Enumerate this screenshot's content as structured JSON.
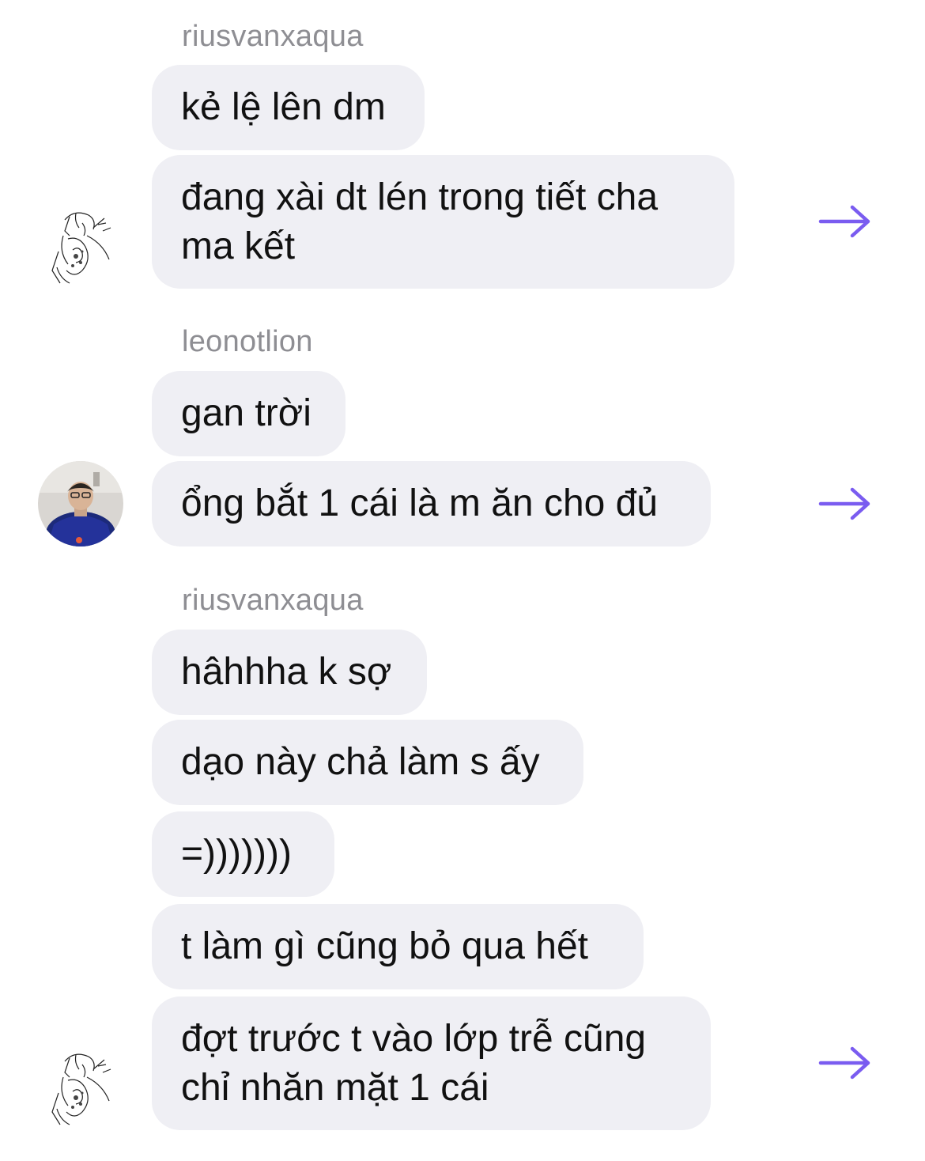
{
  "colors": {
    "bubble_bg": "#efeff4",
    "sender_name": "#8e8e93",
    "message_text": "#111111",
    "forward_arrow": "#7a5cf0"
  },
  "groups": [
    {
      "sender": "riusvanxaqua",
      "avatar_icon": "sketch-illustration-avatar",
      "messages": [
        "kẻ lệ lên dm",
        "đang xài dt lén trong tiết cha ma kết"
      ],
      "action_icon": "forward-arrow-icon"
    },
    {
      "sender": "leonotlion",
      "avatar_icon": "photo-avatar",
      "messages": [
        "gan trời",
        "ổng bắt 1 cái là m ăn cho đủ"
      ],
      "action_icon": "forward-arrow-icon"
    },
    {
      "sender": "riusvanxaqua",
      "avatar_icon": "sketch-illustration-avatar",
      "messages": [
        "hâhhha k sợ",
        "dạo này chả làm s ấy",
        "=)))))))",
        "t làm gì cũng bỏ qua hết",
        "đợt trước t vào lớp trễ cũng chỉ nhăn mặt 1 cái"
      ],
      "action_icon": "forward-arrow-icon"
    }
  ]
}
